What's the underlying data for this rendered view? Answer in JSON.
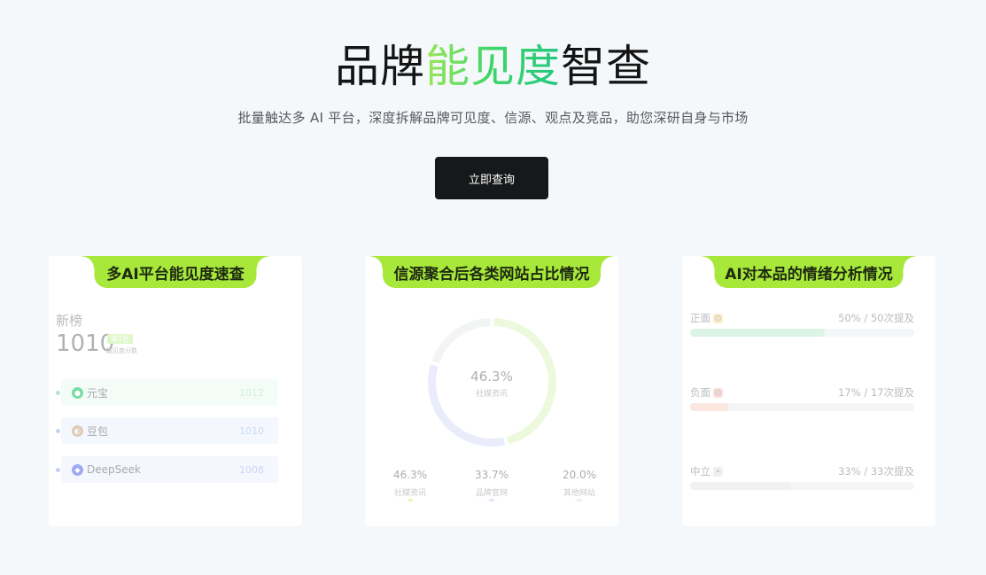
{
  "hero": {
    "title_prefix": "品牌",
    "title_accent": "能见度",
    "title_suffix": "智查",
    "subtitle": "批量触达多 AI 平台，深度拆解品牌可见度、信源、观点及竞品，助您深研自身与市场",
    "cta_label": "立即查询"
  },
  "card1": {
    "tab": "多AI平台能见度速查",
    "label": "新榜",
    "score": "1010",
    "badge": "第1名",
    "score_caption": "能见度分数",
    "platforms": [
      {
        "name": "元宝",
        "value": "1012",
        "icon": "yuanbao-icon",
        "bg": "#eefbf3",
        "dot": "#7fdaa6",
        "color": "#b6e6c9"
      },
      {
        "name": "豆包",
        "value": "1010",
        "icon": "doubao-icon",
        "bg": "#eef5fe",
        "dot": "#9bb8f0",
        "color": "#a9c2f0"
      },
      {
        "name": "DeepSeek",
        "value": "1008",
        "icon": "deepseek-icon",
        "bg": "#eff2fe",
        "dot": "#a0aef0",
        "color": "#aebaf2"
      }
    ]
  },
  "card2": {
    "tab": "信源聚合后各类网站占比情况",
    "center_pct": "46.3%",
    "center_label": "社媒资讯",
    "colors": {
      "social": "#e2f6c8",
      "official": "#dde1fb",
      "other": "#eceeef"
    },
    "chart_data": {
      "type": "pie",
      "categories": [
        "社媒资讯",
        "品牌官网",
        "其他网站"
      ],
      "values": [
        46.3,
        33.7,
        20.0
      ]
    },
    "legend": [
      {
        "pct": "46.3%",
        "name": "社媒资讯",
        "mark": "#f0e98a"
      },
      {
        "pct": "33.7%",
        "name": "品牌官网",
        "mark": "#cfd4f0"
      },
      {
        "pct": "20.0%",
        "name": "其他网站",
        "mark": "#e3e5e7"
      }
    ]
  },
  "card3": {
    "tab": "AI对本品的情绪分析情况",
    "sentiments": [
      {
        "label": "正面",
        "stat": "50% / 50次提及",
        "ratio": 0.6,
        "color": "#c3edd5",
        "emoji_bg": "#fbe3a3",
        "emoji": "happy-face-icon"
      },
      {
        "label": "负面",
        "stat": "17% / 17次提及",
        "ratio": 0.17,
        "color": "#fbd6cd",
        "emoji_bg": "#f8c8c1",
        "emoji": "angry-face-icon"
      },
      {
        "label": "中立",
        "stat": "33% / 33次提及",
        "ratio": 0.45,
        "color": "#e6e8ea",
        "emoji_bg": "#e3e5e8",
        "emoji": "neutral-face-icon"
      }
    ]
  }
}
